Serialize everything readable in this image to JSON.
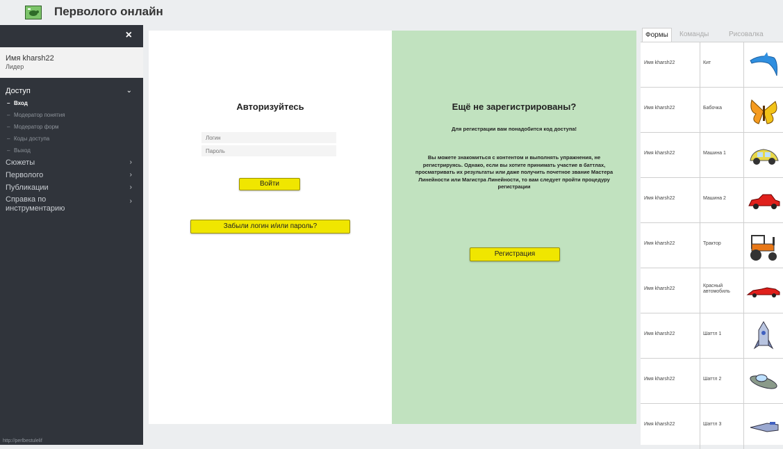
{
  "app": {
    "title": "Перволого онлайн",
    "logo_icon": "turtle-logo-icon"
  },
  "sidebar": {
    "close_icon": "×",
    "user": {
      "name": "Имя kharsh22",
      "role": "Лидер"
    },
    "items": [
      {
        "label": "Доступ",
        "chevron": "⌄",
        "active": true
      },
      {
        "label": "Сюжеты",
        "chevron": "›"
      },
      {
        "label": "Перволого",
        "chevron": "›"
      },
      {
        "label": "Публикации",
        "chevron": "›"
      },
      {
        "label": "Справка по инструментарию",
        "chevron": "›"
      }
    ],
    "subitems": [
      {
        "label": "Вход",
        "current": true
      },
      {
        "label": "Модератор понятия"
      },
      {
        "label": "Модератор форм"
      },
      {
        "label": "Коды доступа"
      },
      {
        "label": "Выход"
      }
    ],
    "footer": "http://perlbestulelif"
  },
  "login": {
    "title": "Авторизуйтесь",
    "login_placeholder": "Логин",
    "password_placeholder": "Пароль",
    "login_button": "Войти",
    "forgot_button": "Забыли логин и/или пароль?"
  },
  "register": {
    "title": "Ещё не зарегистрированы?",
    "need_code": "Для регистрации вам понадобится код доступа!",
    "info": "Вы можете знакомиться с контентом и выполнять упражнения, не регистрируясь. Однако, если вы хотите принимать участие в баттлах, просматривать их результаты или даже получить почетное звание Мастера Линейности или Магистра Линейности, то вам следует пройти процедуру регистрации",
    "button": "Регистрация"
  },
  "gallery": {
    "tabs": [
      "Формы",
      "Команды",
      "Рисовалка"
    ],
    "rows": [
      {
        "author": "Имя kharsh22",
        "name": "Кит",
        "icon": "dolphin-icon"
      },
      {
        "author": "Имя kharsh22",
        "name": "Бабочка",
        "icon": "butterfly-icon"
      },
      {
        "author": "Имя kharsh22",
        "name": "Машина 1",
        "icon": "car-yellow-icon"
      },
      {
        "author": "Имя kharsh22",
        "name": "Машина 2",
        "icon": "car-red-icon"
      },
      {
        "author": "Имя kharsh22",
        "name": "Трактор",
        "icon": "tractor-icon"
      },
      {
        "author": "Имя kharsh22",
        "name": "Красный автомобиль",
        "icon": "red-sportscar-icon"
      },
      {
        "author": "Имя kharsh22",
        "name": "Шаттл 1",
        "icon": "rocket-icon"
      },
      {
        "author": "Имя kharsh22",
        "name": "Шаттл 2",
        "icon": "ufo-icon"
      },
      {
        "author": "Имя kharsh22",
        "name": "Шаттл 3",
        "icon": "spaceship-icon"
      }
    ]
  },
  "colors": {
    "sidebar_bg": "#30343b",
    "register_bg": "#c1e2bf",
    "button_yellow": "#f0e600"
  }
}
